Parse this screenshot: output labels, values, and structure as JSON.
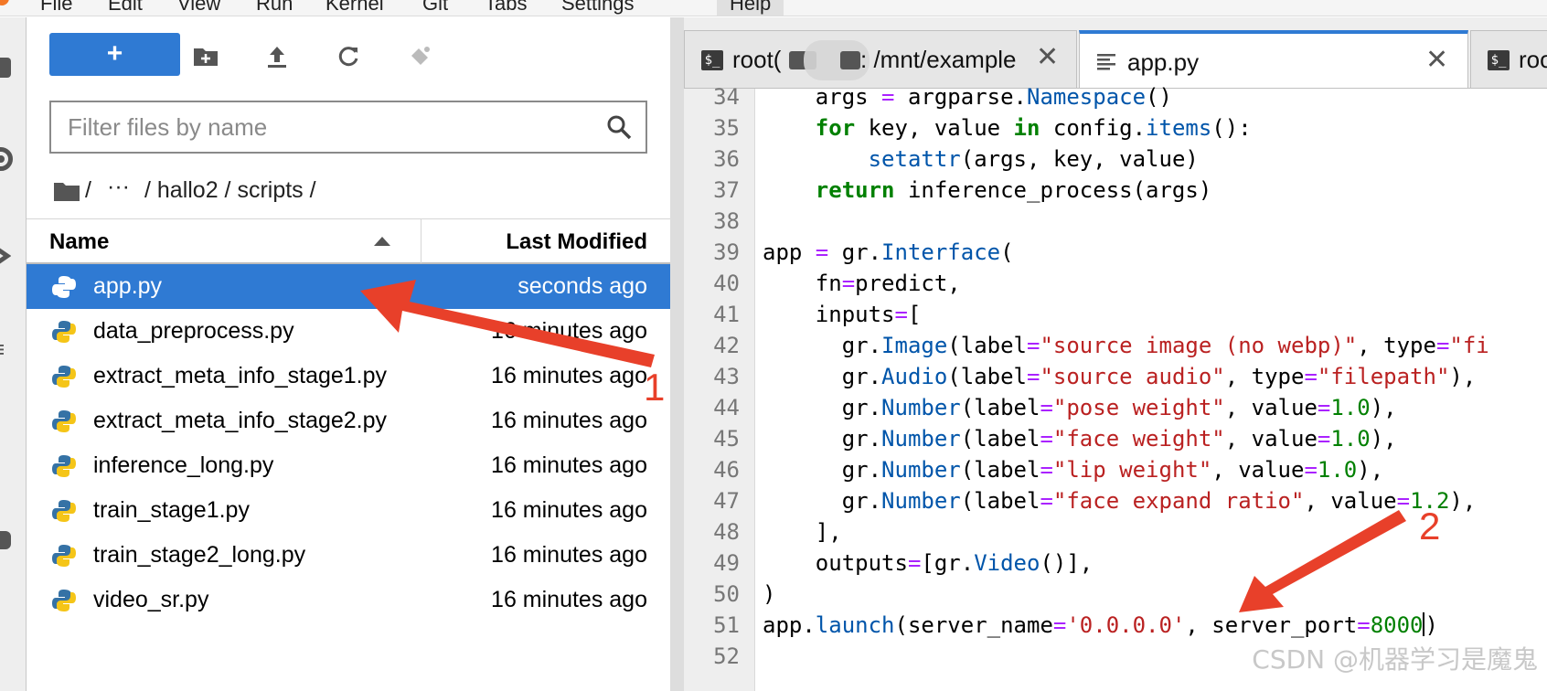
{
  "menubar": {
    "items": [
      "File",
      "Edit",
      "View",
      "Run",
      "Kernel",
      "Git",
      "Tabs",
      "Settings",
      "Help"
    ]
  },
  "filebrowser": {
    "new_launcher_label": "+",
    "filter_placeholder": "Filter files by name",
    "breadcrumbs": [
      "/",
      "···",
      "/ hallo2 / scripts /"
    ],
    "columns": {
      "name": "Name",
      "modified": "Last Modified"
    },
    "files": [
      {
        "name": "app.py",
        "modified": "seconds ago",
        "selected": true
      },
      {
        "name": "data_preprocess.py",
        "modified": "16 minutes ago"
      },
      {
        "name": "extract_meta_info_stage1.py",
        "modified": "16 minutes ago"
      },
      {
        "name": "extract_meta_info_stage2.py",
        "modified": "16 minutes ago"
      },
      {
        "name": "inference_long.py",
        "modified": "16 minutes ago"
      },
      {
        "name": "train_stage1.py",
        "modified": "16 minutes ago"
      },
      {
        "name": "train_stage2_long.py",
        "modified": "16 minutes ago"
      },
      {
        "name": "video_sr.py",
        "modified": "16 minutes ago"
      }
    ]
  },
  "tabs": [
    {
      "label_prefix": "root(",
      "label_suffix": ": /mnt/example",
      "type": "terminal"
    },
    {
      "label": "app.py",
      "type": "file",
      "active": true
    },
    {
      "label": "roo",
      "type": "terminal"
    }
  ],
  "editor": {
    "line_numbers": [
      "34",
      "35",
      "36",
      "37",
      "38",
      "39",
      "40",
      "41",
      "42",
      "43",
      "44",
      "45",
      "46",
      "47",
      "48",
      "49",
      "50",
      "51",
      "52"
    ],
    "lines": [
      "    args = argparse.Namespace()",
      "    for key, value in config.items():",
      "        setattr(args, key, value)",
      "    return inference_process(args)",
      "",
      "app = gr.Interface(",
      "    fn=predict,",
      "    inputs=[",
      "      gr.Image(label=\"source image (no webp)\", type=\"fi",
      "      gr.Audio(label=\"source audio\", type=\"filepath\"),",
      "      gr.Number(label=\"pose weight\", value=1.0),",
      "      gr.Number(label=\"face weight\", value=1.0),",
      "      gr.Number(label=\"lip weight\", value=1.0),",
      "      gr.Number(label=\"face expand ratio\", value=1.2),",
      "    ],",
      "    outputs=[gr.Video()],",
      ")",
      "app.launch(server_name='0.0.0.0', server_port=8000)",
      ""
    ]
  },
  "annotations": {
    "label_1": "1",
    "label_2": "2"
  },
  "watermark": "CSDN @机器学习是魔鬼",
  "colors": {
    "accent": "#2f7ad3",
    "annotation": "#e8402a"
  }
}
